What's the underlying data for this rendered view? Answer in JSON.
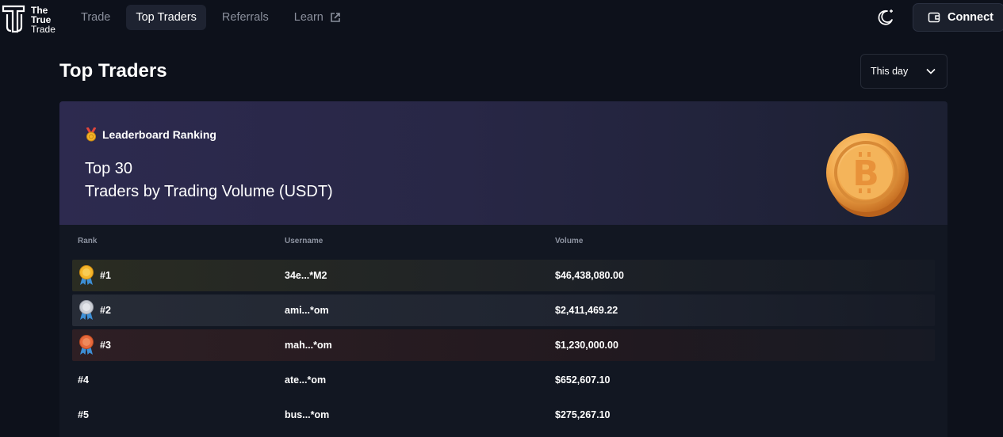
{
  "brand": {
    "line1": "The",
    "line2": "True",
    "line3": "Trade"
  },
  "nav": [
    {
      "label": "Trade",
      "active": false
    },
    {
      "label": "Top Traders",
      "active": true
    },
    {
      "label": "Referrals",
      "active": false
    },
    {
      "label": "Learn",
      "active": false,
      "icon": "external-link-icon"
    }
  ],
  "header": {
    "theme_icon": "moon-icon",
    "connect_label": "Connect",
    "connect_icon": "wallet-icon"
  },
  "page": {
    "title": "Top Traders",
    "period": "This day"
  },
  "banner": {
    "kicker": "Leaderboard Ranking",
    "kicker_icon": "medal-icon",
    "title_line1": "Top 30",
    "title_line2": "Traders by Trading Volume (USDT)",
    "art": "bitcoin-coin"
  },
  "table": {
    "columns": {
      "rank": "Rank",
      "username": "Username",
      "volume": "Volume"
    },
    "rows": [
      {
        "rank": "#1",
        "username": "34e...*M2",
        "volume": "$46,438,080.00",
        "medal": "gold"
      },
      {
        "rank": "#2",
        "username": "ami...*om",
        "volume": "$2,411,469.22",
        "medal": "silver"
      },
      {
        "rank": "#3",
        "username": "mah...*om",
        "volume": "$1,230,000.00",
        "medal": "bronze"
      },
      {
        "rank": "#4",
        "username": "ate...*om",
        "volume": "$652,607.10"
      },
      {
        "rank": "#5",
        "username": "bus...*om",
        "volume": "$275,267.10"
      }
    ]
  },
  "colors": {
    "background": "#0d111b",
    "banner": "#2d2a4f",
    "gold": "#f5b52a",
    "silver": "#c9ccd3",
    "bronze": "#e7683b"
  }
}
